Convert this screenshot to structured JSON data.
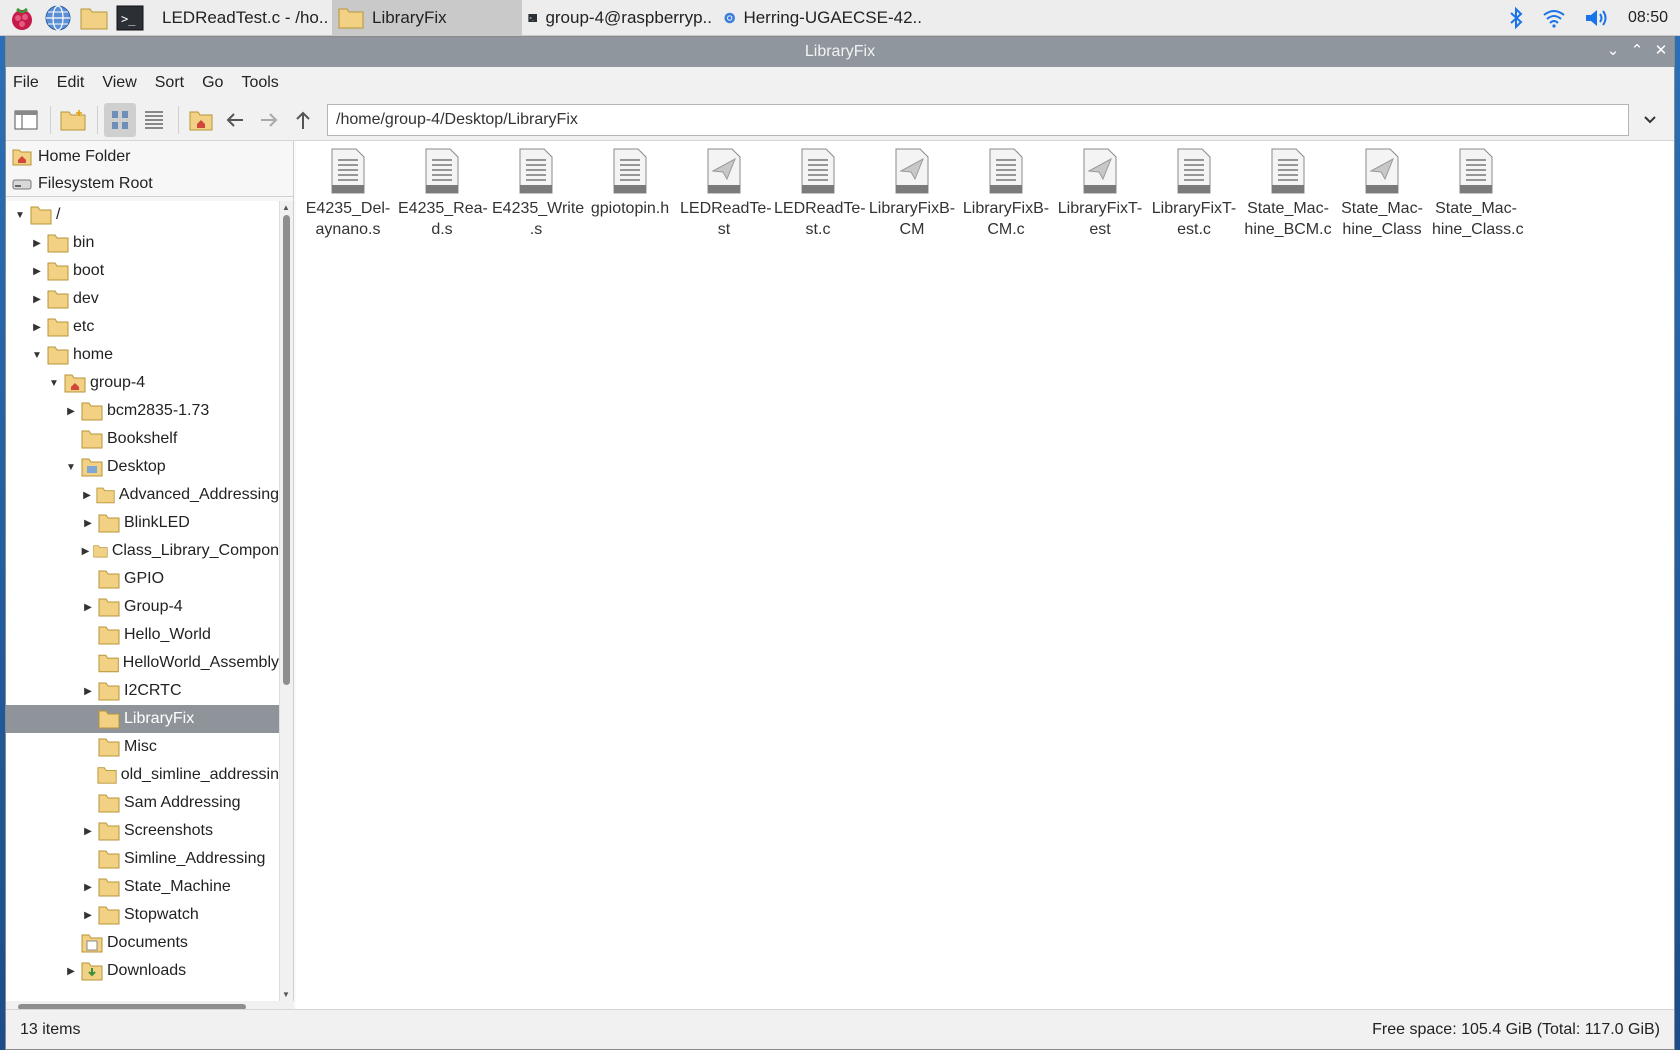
{
  "taskbar": {
    "tasks": [
      {
        "label": "LEDReadTest.c - /ho.."
      },
      {
        "label": "LibraryFix"
      },
      {
        "label": "group-4@raspberryp.."
      },
      {
        "label": "Herring-UGAECSE-42.."
      }
    ],
    "clock": "08:50"
  },
  "window": {
    "title": "LibraryFix",
    "menu": [
      "File",
      "Edit",
      "View",
      "Sort",
      "Go",
      "Tools"
    ],
    "path": "/home/group-4/Desktop/LibraryFix"
  },
  "places": [
    {
      "label": "Home Folder"
    },
    {
      "label": "Filesystem Root"
    }
  ],
  "tree": [
    {
      "label": "/",
      "exp": "down"
    },
    {
      "label": "bin",
      "exp": "right"
    },
    {
      "label": "boot",
      "exp": "right"
    },
    {
      "label": "dev",
      "exp": "right"
    },
    {
      "label": "etc",
      "exp": "right"
    },
    {
      "label": "home",
      "exp": "down"
    },
    {
      "label": "group-4",
      "exp": "down"
    },
    {
      "label": "bcm2835-1.73",
      "exp": "right"
    },
    {
      "label": "Bookshelf",
      "exp": ""
    },
    {
      "label": "Desktop",
      "exp": "down"
    },
    {
      "label": "Advanced_Addressing",
      "exp": "right"
    },
    {
      "label": "BlinkLED",
      "exp": "right"
    },
    {
      "label": "Class_Library_Compon",
      "exp": "right"
    },
    {
      "label": "GPIO",
      "exp": ""
    },
    {
      "label": "Group-4",
      "exp": "right"
    },
    {
      "label": "Hello_World",
      "exp": ""
    },
    {
      "label": "HelloWorld_Assembly",
      "exp": ""
    },
    {
      "label": "I2CRTC",
      "exp": "right"
    },
    {
      "label": "LibraryFix",
      "exp": ""
    },
    {
      "label": "Misc",
      "exp": ""
    },
    {
      "label": "old_simline_addressin",
      "exp": ""
    },
    {
      "label": "Sam Addressing",
      "exp": ""
    },
    {
      "label": "Screenshots",
      "exp": "right"
    },
    {
      "label": "Simline_Addressing",
      "exp": ""
    },
    {
      "label": "State_Machine",
      "exp": "right"
    },
    {
      "label": "Stopwatch",
      "exp": "right"
    },
    {
      "label": "Documents",
      "exp": ""
    },
    {
      "label": "Downloads",
      "exp": "right"
    }
  ],
  "files": [
    {
      "line1": "E4235_Del-",
      "line2": "aynano.s",
      "icon": "text-file-icon"
    },
    {
      "line1": "E4235_Rea-",
      "line2": "d.s",
      "icon": "text-file-icon"
    },
    {
      "line1": "E4235_Write",
      "line2": ".s",
      "icon": "text-file-icon"
    },
    {
      "line1": "gpiotopin.h",
      "line2": "",
      "icon": "text-file-icon"
    },
    {
      "line1": "LEDReadTe-",
      "line2": "st",
      "icon": "executable-file-icon"
    },
    {
      "line1": "LEDReadTe-",
      "line2": "st.c",
      "icon": "text-file-icon"
    },
    {
      "line1": "LibraryFixB-",
      "line2": "CM",
      "icon": "executable-file-icon"
    },
    {
      "line1": "LibraryFixB-",
      "line2": "CM.c",
      "icon": "text-file-icon"
    },
    {
      "line1": "LibraryFixT-",
      "line2": "est",
      "icon": "executable-file-icon"
    },
    {
      "line1": "LibraryFixT-",
      "line2": "est.c",
      "icon": "text-file-icon"
    },
    {
      "line1": "State_Mac-",
      "line2": "hine_BCM.c",
      "icon": "text-file-icon"
    },
    {
      "line1": "State_Mac-",
      "line2": "hine_Class",
      "icon": "executable-file-icon"
    },
    {
      "line1": "State_Mac-",
      "line2": "hine_Class.c",
      "icon": "text-file-icon"
    }
  ],
  "status": {
    "items": "13 items",
    "free": "Free space: 105.4 GiB (Total: 117.0 GiB)"
  },
  "colors": {
    "selection": "#8e949a",
    "titlebar": "#8f969d",
    "folder": "#f2d184"
  }
}
